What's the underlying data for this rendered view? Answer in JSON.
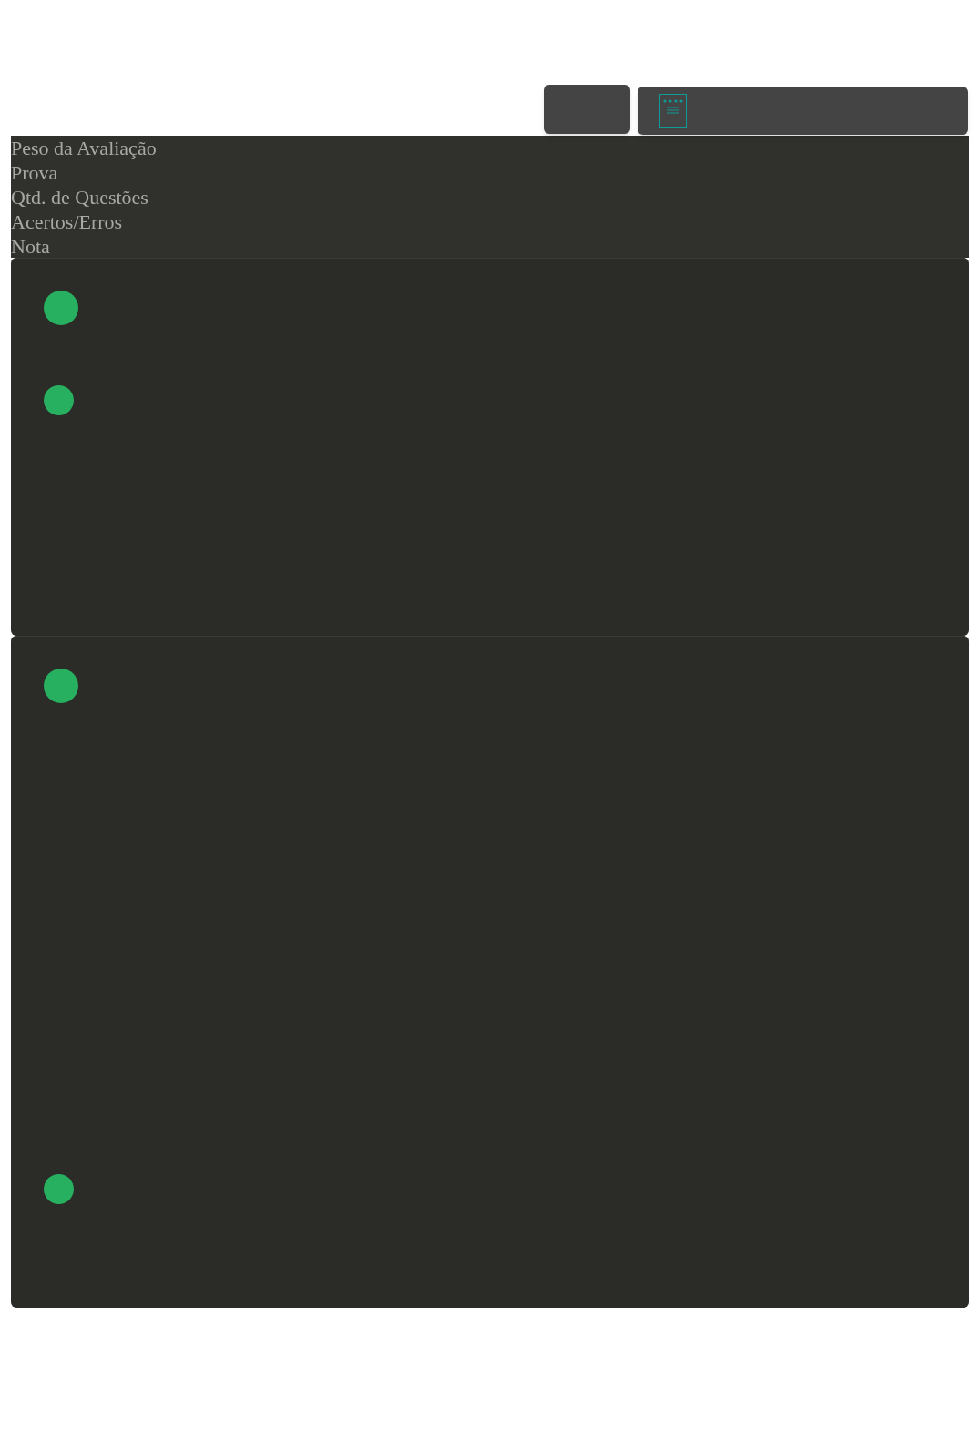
{
  "toolbar": {
    "buttons": [
      {
        "kind": "blank"
      },
      {
        "kind": "document"
      }
    ]
  },
  "header": {
    "labels": [
      "Peso da Avaliação",
      "Prova",
      "Qtd. de Questões",
      "Acertos/Erros",
      "Nota"
    ]
  },
  "cards": [
    {
      "dots": [
        {
          "kind": "large"
        },
        {
          "kind": "small"
        }
      ]
    },
    {
      "dots": [
        {
          "kind": "large"
        },
        {
          "kind": "small"
        }
      ]
    }
  ]
}
